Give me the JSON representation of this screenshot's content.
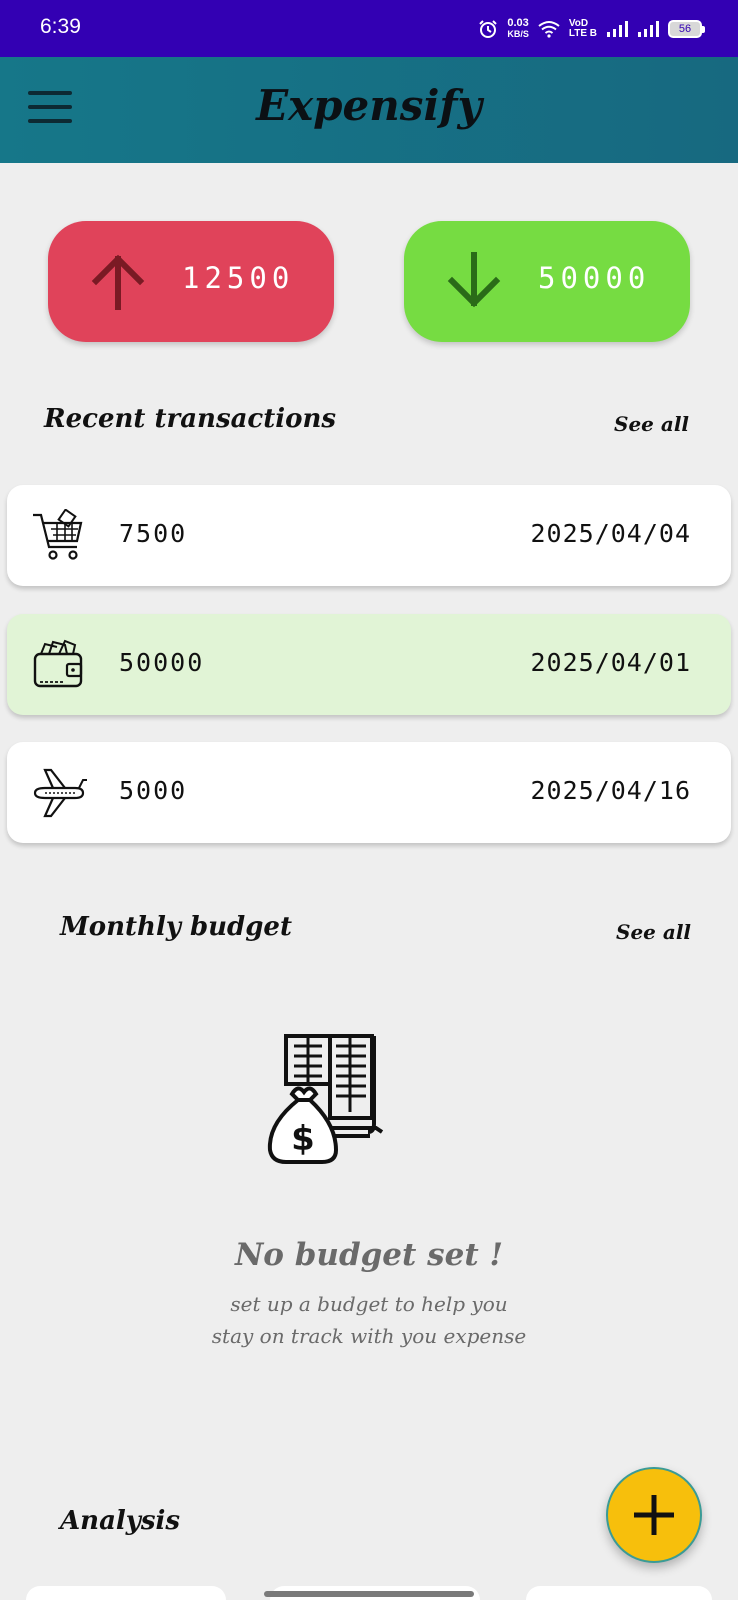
{
  "status_bar": {
    "time": "6:39",
    "net_speed_value": "0.03",
    "net_speed_unit": "KB/S",
    "volte_top": "VoD",
    "volte_bottom": "LTE B",
    "battery": "56",
    "icons": [
      "alarm-icon",
      "wifi-icon",
      "signal-icon",
      "signal-icon",
      "battery-icon"
    ]
  },
  "app_bar": {
    "title": "Expensify",
    "menu_icon": "hamburger-menu-icon",
    "color": "#167789"
  },
  "summary": {
    "expense": {
      "amount": "12500",
      "icon": "arrow-up-icon",
      "color": "#e0435a"
    },
    "income": {
      "amount": "50000",
      "icon": "arrow-down-icon",
      "color": "#76dc42"
    }
  },
  "recent": {
    "title": "Recent transactions",
    "see_all": "See all",
    "items": [
      {
        "icon": "shopping-cart-icon",
        "amount": "7500",
        "date": "2025/04/04",
        "highlight": false
      },
      {
        "icon": "wallet-icon",
        "amount": "50000",
        "date": "2025/04/01",
        "highlight": true
      },
      {
        "icon": "airplane-icon",
        "amount": "5000",
        "date": "2025/04/16",
        "highlight": false
      }
    ]
  },
  "budget": {
    "title": "Monthly budget",
    "see_all": "See all",
    "empty_title": "No budget set !",
    "empty_line1": "set up a budget to help you",
    "empty_line2": "stay on track with you expense",
    "illustration": "budget-money-bag-book-icon"
  },
  "analysis": {
    "title": "Analysis"
  },
  "fab": {
    "icon": "plus-icon",
    "color": "#f7bf0c"
  }
}
